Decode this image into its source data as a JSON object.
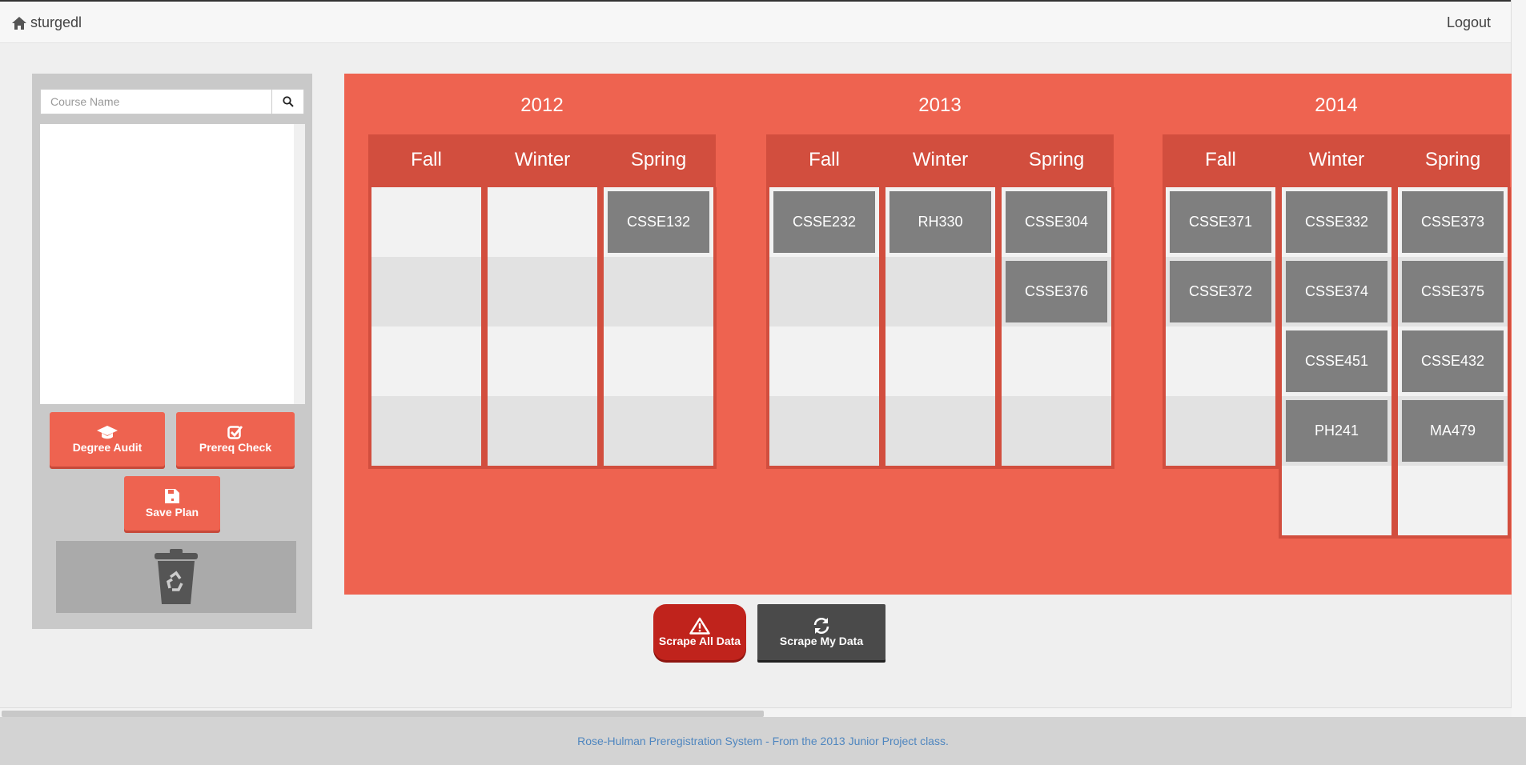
{
  "header": {
    "username": "sturgedl",
    "logout_label": "Logout"
  },
  "sidebar": {
    "search_placeholder": "Course Name",
    "degree_audit_label": "Degree Audit",
    "prereq_check_label": "Prereq Check",
    "save_plan_label": "Save Plan"
  },
  "years": [
    {
      "year": "2012",
      "terms": [
        {
          "name": "Fall",
          "courses": []
        },
        {
          "name": "Winter",
          "courses": []
        },
        {
          "name": "Spring",
          "courses": [
            "CSSE132"
          ]
        }
      ]
    },
    {
      "year": "2013",
      "terms": [
        {
          "name": "Fall",
          "courses": [
            "CSSE232"
          ]
        },
        {
          "name": "Winter",
          "courses": [
            "RH330"
          ]
        },
        {
          "name": "Spring",
          "courses": [
            "CSSE304",
            "CSSE376"
          ]
        }
      ]
    },
    {
      "year": "2014",
      "terms": [
        {
          "name": "Fall",
          "courses": [
            "CSSE371",
            "CSSE372"
          ]
        },
        {
          "name": "Winter",
          "courses": [
            "CSSE332",
            "CSSE374",
            "CSSE451",
            "PH241"
          ]
        },
        {
          "name": "Spring",
          "courses": [
            "CSSE373",
            "CSSE375",
            "CSSE432",
            "MA479"
          ]
        }
      ]
    }
  ],
  "actions": {
    "scrape_all_label": "Scrape All Data",
    "scrape_mine_label": "Scrape My Data"
  },
  "footer": {
    "text": "Rose-Hulman Preregistration System - From the 2013 Junior Project class."
  },
  "colors": {
    "board": "#ee6350",
    "header_band": "#d24e3e",
    "course_tile": "#7f7f7f",
    "scrape_all": "#c0231c",
    "scrape_mine": "#4a4a4a"
  }
}
